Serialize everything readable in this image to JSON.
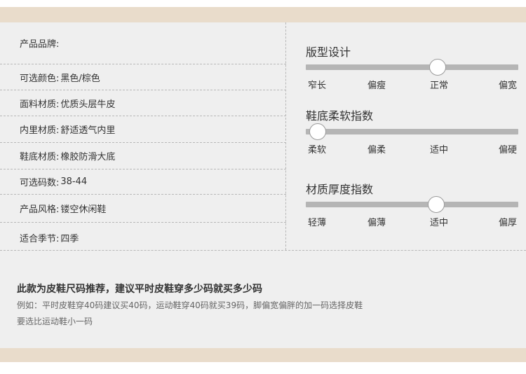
{
  "specs": [
    {
      "label": "产品品牌:",
      "value": ""
    },
    {
      "label": "可选颜色:",
      "value": "黑色/棕色"
    },
    {
      "label": "面料材质:",
      "value": "优质头层牛皮"
    },
    {
      "label": "内里材质:",
      "value": "舒适透气内里"
    },
    {
      "label": "鞋底材质:",
      "value": "橡胶防滑大底"
    },
    {
      "label": "可选码数:",
      "value": "38-44"
    },
    {
      "label": "产品风格:",
      "value": "镂空休闲鞋"
    },
    {
      "label": "适合季节:",
      "value": "四季"
    }
  ],
  "scales": [
    {
      "title": "版型设计",
      "ticks": [
        "窄长",
        "偏瘦",
        "正常",
        "偏宽"
      ],
      "level": 0.62
    },
    {
      "title": "鞋底柔软指数",
      "ticks": [
        "柔软",
        "偏柔",
        "适中",
        "偏硬"
      ],
      "level": 0.055
    },
    {
      "title": "材质厚度指数",
      "ticks": [
        "轻薄",
        "偏薄",
        "适中",
        "偏厚"
      ],
      "level": 0.615
    }
  ],
  "size_note": {
    "title": "此款为皮鞋尺码推荐，建议平时皮鞋穿多少码就买多少码",
    "line1": "例如：平时皮鞋穿40码建议买40码，运动鞋穿40码就买39码，脚偏宽偏胖的加一码选择皮鞋",
    "line2": "要选比运动鞋小一码"
  },
  "colors": {
    "band": "#e9dccb",
    "panel": "#efefef",
    "track": "#b5b5b5"
  }
}
